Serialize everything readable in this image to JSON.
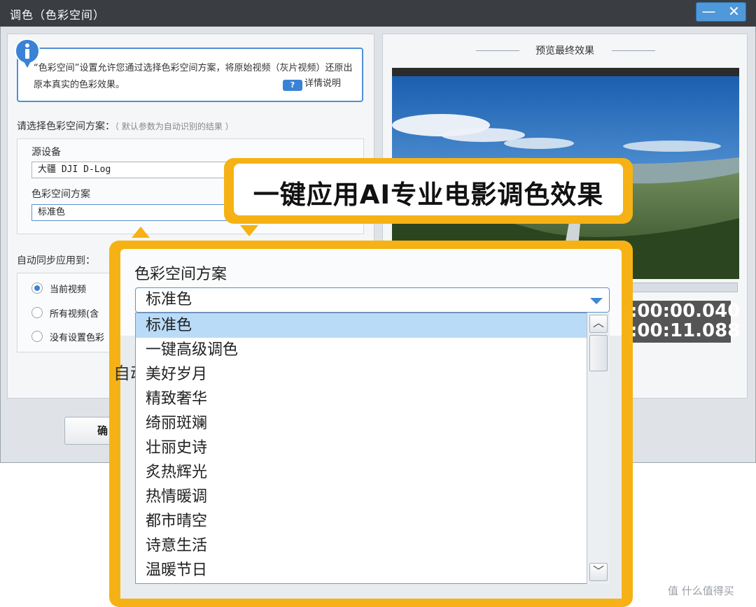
{
  "window": {
    "title": "调色（色彩空间）",
    "minimize": "—",
    "close": "✕"
  },
  "info": {
    "text": "“色彩空间”设置允许您通过选择色彩空间方案，将原始视频（灰片视频）还原出原本真实的色彩效果。",
    "help_icon_text": "?",
    "help_label": "详情说明"
  },
  "scheme_section": {
    "label": "请选择色彩空间方案：",
    "hint": "（ 默认参数为自动识别的结果 ）",
    "source_label": "源设备",
    "source_value": "大疆 DJI D-Log",
    "color_label": "色彩空间方案",
    "color_value": "标准色"
  },
  "sync_section": {
    "label": "自动同步应用到：",
    "options": [
      "当前视频",
      "所有视频(含",
      "没有设置色彩"
    ],
    "selected_index": 0
  },
  "ok_button": "确",
  "preview": {
    "title": "预览最终效果",
    "time_current": ":00:00.040",
    "time_total": ":00:11.088",
    "progress": 0.01
  },
  "callout": {
    "text": "一键应用AI专业电影调色效果"
  },
  "zoom": {
    "label": "色彩空间方案",
    "selected_value": "标准色",
    "ghost_text": "自动",
    "options": [
      "标准色",
      "一键高级调色",
      "美好岁月",
      "精致奢华",
      "绮丽斑斓",
      "壮丽史诗",
      "炙热辉光",
      "热情暖调",
      "都市晴空",
      "诗意生活",
      "温暖节日"
    ],
    "highlighted_index": 0,
    "scroll_up": "︿",
    "scroll_down": "﹀"
  },
  "watermark": "值 什么值得买",
  "colors": {
    "accent": "#f6b214",
    "titlebar": "#3a3d42",
    "selection": "#b9dbf7",
    "link_blue": "#3a82d6"
  }
}
